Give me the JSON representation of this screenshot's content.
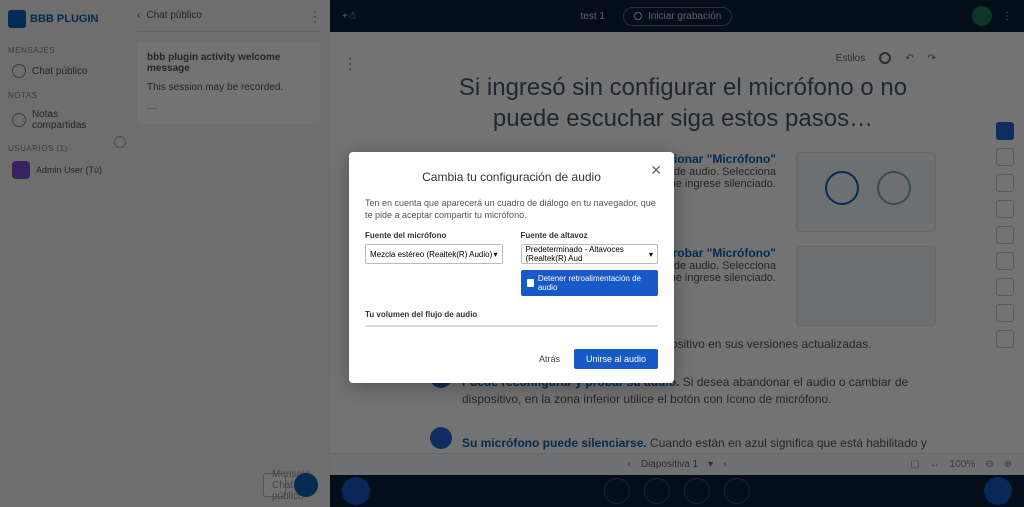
{
  "logo": "BBB PLUGIN",
  "nav": {
    "sect_msgs": "MENSAJES",
    "chat_public": "Chat público",
    "sect_notes": "NOTAS",
    "notes_shared": "Notas compartidas",
    "sect_users": "USUARIOS (1)",
    "user": "Admin User (Tú)"
  },
  "chat": {
    "header": "Chat público",
    "msg_title": "bbb plugin activity welcome message",
    "msg_body": "This session may be recorded.",
    "placeholder": "Mensaje Chat público"
  },
  "top": {
    "session": "test 1",
    "record": "Iniciar grabación"
  },
  "wb": {
    "styles": "Estilos",
    "title": "Si ingresó sin configurar el micrófono o no puede escuchar siga estos pasos…",
    "step1_h": "Seleccionar \"Micrófono\"",
    "step1_b": "Verá un diálogo para seleccionar el modo de audio. Selecciona micrófono. Es posible que ingrese silenciado.",
    "step2_h": "Comprobar \"Micrófono\"",
    "step2_b": "Verá un diálogo para seleccionar el modo de audio. Selecciona micrófono. Es posible que ingrese silenciado.",
    "p_browser": "rome y Firefox Compatible con cualquier dispositivo en sus versiones actualizadas.",
    "p_reconf_h": "Puede reconfigurar y probar su audio.",
    "p_reconf_b": " Si desea abandonar el audio o cambiar de dispositivo, en la zona inferior utilice el botón con ícono de micrófono.",
    "p_mute_h": "Su micrófono puede silenciarse.",
    "p_mute_b": " Cuando están en azul significa que está habilitado y viceversa. El moderador también podrá bloquear o silenciar los micrófonos."
  },
  "slide": {
    "label": "Diapositiva 1",
    "zoom": "100%"
  },
  "modal": {
    "title": "Cambia tu configuración de audio",
    "desc": "Ten en cuenta que aparecerá un cuadro de diálogo en tu navegador, que te pide a aceptar compartir tu micrófono.",
    "mic_label": "Fuente del micrófono",
    "mic_value": "Mezcla estéreo (Realtek(R) Audio)",
    "spk_label": "Fuente de altavoz",
    "spk_value": "Predeterminado - Altavoces (Realtek(R) Aud",
    "stop": "Detener retroalimentación de audio",
    "vol_label": "Tu volumen del flujo de audio",
    "back": "Atrás",
    "join": "Unirse al audio"
  }
}
